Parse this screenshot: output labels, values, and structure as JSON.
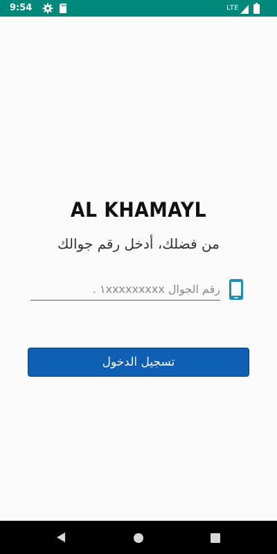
{
  "status_bar": {
    "time": "9:54",
    "network": "LTE",
    "icons": [
      "gear-icon",
      "sd-card-icon",
      "signal-icon",
      "battery-icon"
    ],
    "background_color": "#00897b"
  },
  "title": "AL KHAMAYL",
  "instruction": "من فضلك، أدخل رقم جوالك",
  "phone_input": {
    "placeholder": "رقم الجوال ١xxxxxxxxx .",
    "value": "",
    "icon": "mobile-phone-icon",
    "accent_color": "#1a6fa8"
  },
  "login_button": {
    "label": "تسجيل الدخول",
    "color": "#0f5fb5"
  },
  "nav_bar": {
    "icons": [
      "back-icon",
      "home-icon",
      "recents-icon"
    ]
  }
}
